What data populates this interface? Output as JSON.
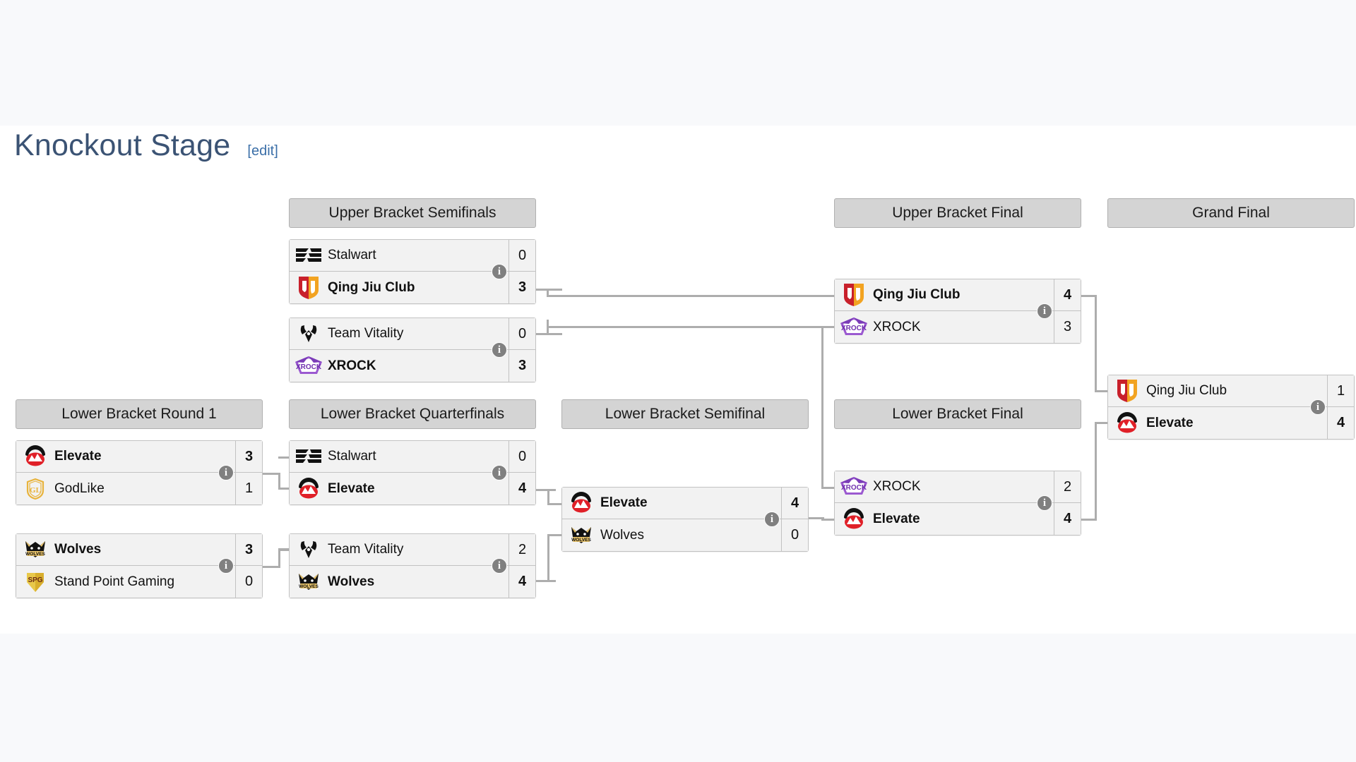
{
  "page": {
    "title": "Knockout Stage",
    "edit_label": "[edit]"
  },
  "rounds": {
    "ubsf": "Upper Bracket Semifinals",
    "ubf": "Upper Bracket Final",
    "gf": "Grand Final",
    "lbr1": "Lower Bracket Round 1",
    "lbqf": "Lower Bracket Quarterfinals",
    "lbsf": "Lower Bracket Semifinal",
    "lbf": "Lower Bracket Final"
  },
  "info_badge": "i",
  "matches": {
    "ubsf1": {
      "top": {
        "team": "Stalwart",
        "logo": "stalwart-logo",
        "score": "0",
        "winner": false
      },
      "bottom": {
        "team": "Qing Jiu Club",
        "logo": "qing-jiu-club-logo",
        "score": "3",
        "winner": true
      }
    },
    "ubsf2": {
      "top": {
        "team": "Team Vitality",
        "logo": "team-vitality-logo",
        "score": "0",
        "winner": false
      },
      "bottom": {
        "team": "XROCK",
        "logo": "xrock-logo",
        "score": "3",
        "winner": true
      }
    },
    "ubf": {
      "top": {
        "team": "Qing Jiu Club",
        "logo": "qing-jiu-club-logo",
        "score": "4",
        "winner": true
      },
      "bottom": {
        "team": "XROCK",
        "logo": "xrock-logo",
        "score": "3",
        "winner": false
      }
    },
    "gf": {
      "top": {
        "team": "Qing Jiu Club",
        "logo": "qing-jiu-club-logo",
        "score": "1",
        "winner": false
      },
      "bottom": {
        "team": "Elevate",
        "logo": "elevate-logo",
        "score": "4",
        "winner": true
      }
    },
    "lbr1a": {
      "top": {
        "team": "Elevate",
        "logo": "elevate-logo",
        "score": "3",
        "winner": true
      },
      "bottom": {
        "team": "GodLike",
        "logo": "godlike-logo",
        "score": "1",
        "winner": false
      }
    },
    "lbr1b": {
      "top": {
        "team": "Wolves",
        "logo": "wolves-logo",
        "score": "3",
        "winner": true
      },
      "bottom": {
        "team": "Stand Point Gaming",
        "logo": "stand-point-gaming-logo",
        "score": "0",
        "winner": false
      }
    },
    "lbqf1": {
      "top": {
        "team": "Stalwart",
        "logo": "stalwart-logo",
        "score": "0",
        "winner": false
      },
      "bottom": {
        "team": "Elevate",
        "logo": "elevate-logo",
        "score": "4",
        "winner": true
      }
    },
    "lbqf2": {
      "top": {
        "team": "Team Vitality",
        "logo": "team-vitality-logo",
        "score": "2",
        "winner": false
      },
      "bottom": {
        "team": "Wolves",
        "logo": "wolves-logo",
        "score": "4",
        "winner": true
      }
    },
    "lbsf": {
      "top": {
        "team": "Elevate",
        "logo": "elevate-logo",
        "score": "4",
        "winner": true
      },
      "bottom": {
        "team": "Wolves",
        "logo": "wolves-logo",
        "score": "0",
        "winner": false
      }
    },
    "lbf": {
      "top": {
        "team": "XROCK",
        "logo": "xrock-logo",
        "score": "2",
        "winner": false
      },
      "bottom": {
        "team": "Elevate",
        "logo": "elevate-logo",
        "score": "4",
        "winner": true
      }
    }
  },
  "colors": {
    "title": "#3b5374",
    "link": "#3b6fa8",
    "header_bg": "#d4d4d4",
    "match_bg": "#f2f2f2",
    "border": "#c2c2c2",
    "connector": "#adadad",
    "badge": "#808080"
  }
}
